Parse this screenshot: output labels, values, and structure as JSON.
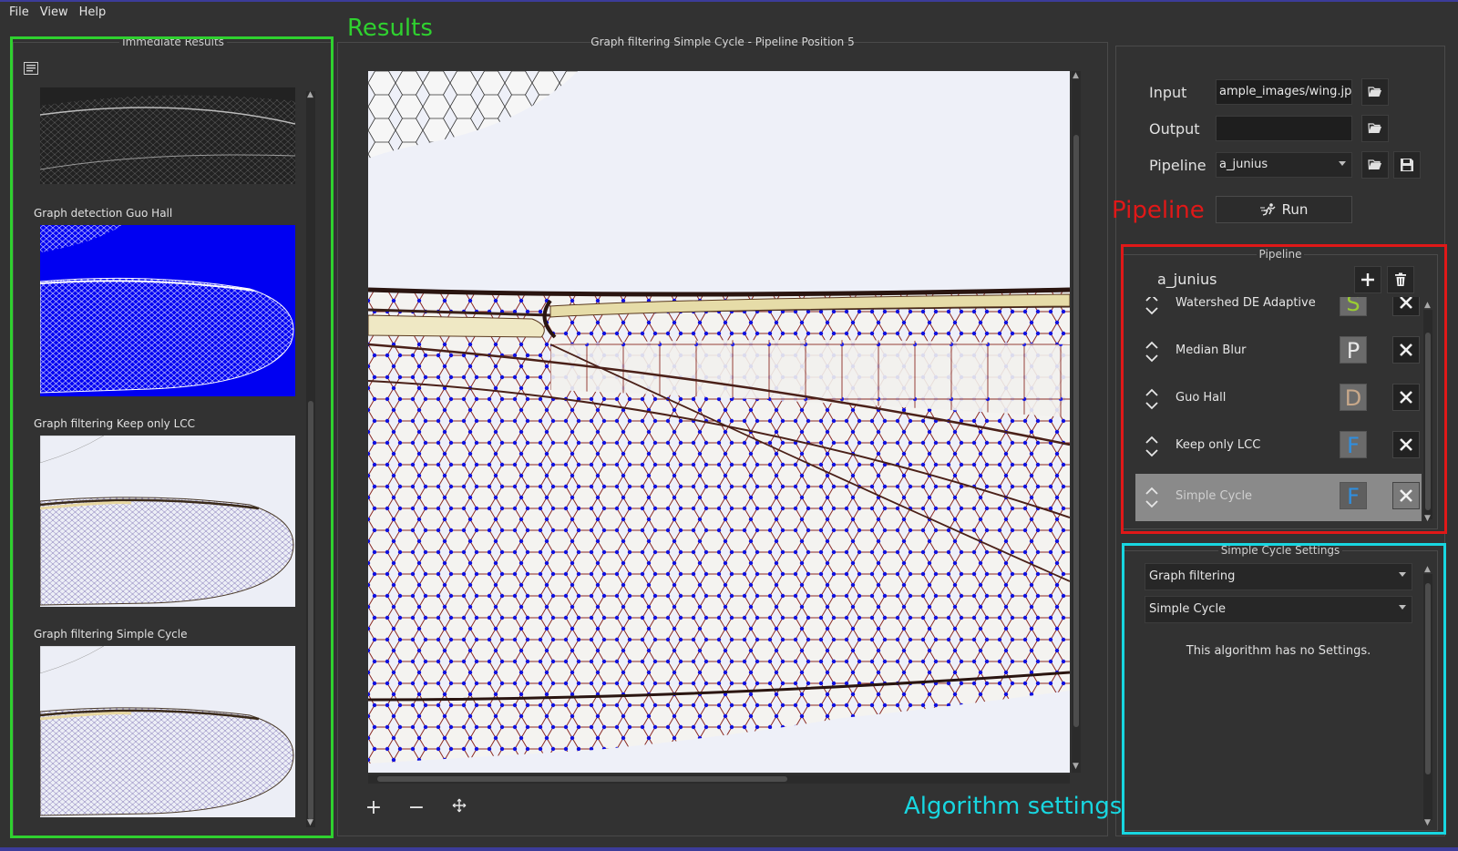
{
  "menu": {
    "file": "File",
    "view": "View",
    "help": "Help"
  },
  "annotations": {
    "results": "Results",
    "pipeline": "Pipeline",
    "algorithm_settings": "Algorithm settings",
    "colors": {
      "results": "#2fd12f",
      "pipeline": "#e01818",
      "settings": "#18d6e0"
    }
  },
  "results_panel": {
    "title": "Immediate Results",
    "items": [
      {
        "caption": "Graph detection Guo Hall",
        "image": "wing-blue-detection"
      },
      {
        "caption": "Graph filtering Keep only LCC",
        "image": "wing-graph-lcc"
      },
      {
        "caption": "Graph filtering Simple Cycle",
        "image": "wing-graph-simple-cycle"
      }
    ],
    "first_image": "wing-gray-segmentation"
  },
  "viewer": {
    "title": "Graph filtering Simple Cycle - Pipeline Position 5",
    "zoom_in": "+",
    "zoom_out": "−",
    "fit": "⤧"
  },
  "io": {
    "input_label": "Input",
    "input_value": "ample_images/wing.jpg",
    "output_label": "Output",
    "output_value": "",
    "pipeline_label": "Pipeline",
    "pipeline_value": "a_junius",
    "run_label": "Run"
  },
  "pipeline": {
    "title": "Pipeline",
    "name": "a_junius",
    "steps": [
      {
        "name": "Watershed DE Adaptive",
        "badge": "S",
        "badge_color": "#9acd32",
        "selected": false
      },
      {
        "name": "Median Blur",
        "badge": "P",
        "badge_color": "#e8e8e8",
        "selected": false
      },
      {
        "name": "Guo Hall",
        "badge": "D",
        "badge_color": "#c8a88a",
        "selected": false
      },
      {
        "name": "Keep only LCC",
        "badge": "F",
        "badge_color": "#2f8fe0",
        "selected": false
      },
      {
        "name": "Simple Cycle",
        "badge": "F",
        "badge_color": "#2f8fe0",
        "selected": true
      }
    ]
  },
  "settings": {
    "title": "Simple Cycle Settings",
    "category": "Graph filtering",
    "algorithm": "Simple Cycle",
    "message": "This algorithm has no Settings."
  }
}
